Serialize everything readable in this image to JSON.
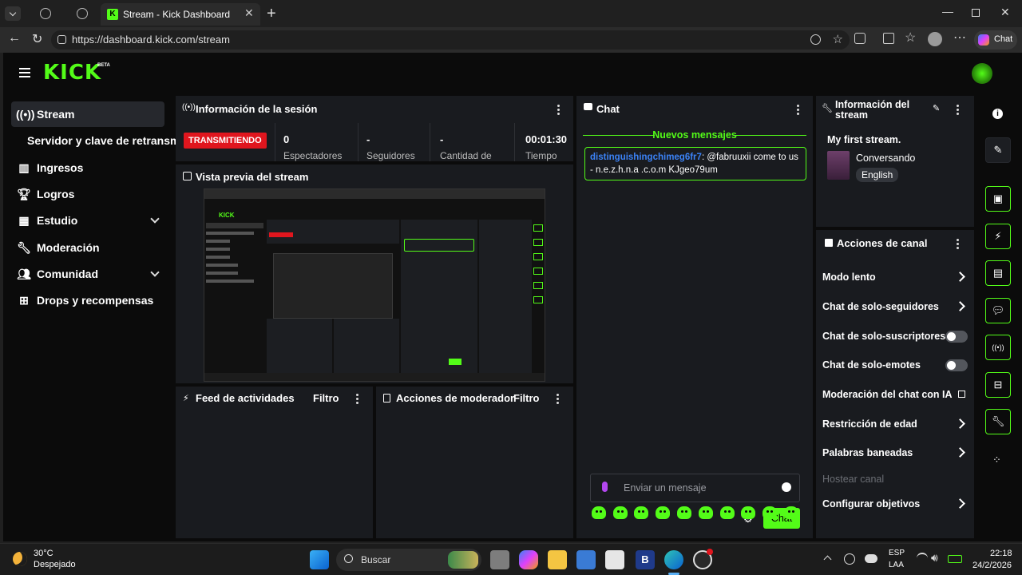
{
  "browser": {
    "tab_title": "Stream - Kick Dashboard",
    "url": "https://dashboard.kick.com/stream",
    "copilot_label": "Chat"
  },
  "brand": {
    "logo": "KICK",
    "beta": "BETA",
    "accent": "#53fc18"
  },
  "sidebar": {
    "items": [
      {
        "label": "Stream",
        "icon": "broadcast-icon"
      },
      {
        "label": "Servidor y clave de retransm"
      },
      {
        "label": "Ingresos",
        "icon": "chart-icon"
      },
      {
        "label": "Logros",
        "icon": "trophy-icon"
      },
      {
        "label": "Estudio",
        "icon": "studio-icon"
      },
      {
        "label": "Moderación",
        "icon": "wrench-icon"
      },
      {
        "label": "Comunidad",
        "icon": "people-icon"
      },
      {
        "label": "Drops y recompensas",
        "icon": "gift-icon"
      }
    ]
  },
  "session": {
    "title": "Información de la sesión",
    "status": "TRANSMITIENDO",
    "stats": [
      {
        "value": "0",
        "label": "Espectadores"
      },
      {
        "value": "-",
        "label": "Seguidores"
      },
      {
        "value": "-",
        "label": "Cantidad de"
      },
      {
        "value": "00:01:30",
        "label": "Tiempo"
      }
    ]
  },
  "preview": {
    "title": "Vista previa del stream"
  },
  "feed": {
    "title": "Feed de actividades",
    "filter": "Filtro"
  },
  "modactions": {
    "title": "Acciones de moderador",
    "filter": "Filtro"
  },
  "chat": {
    "title": "Chat",
    "new_messages": "Nuevos mensajes",
    "message": {
      "user": "distinguishingchimeg6fr7",
      "sep": ":",
      "text": " @fabruuxii come to us - n.e.z.h.n.a .c.o.m KJgeo79um"
    },
    "placeholder": "Enviar un mensaje",
    "send": "Chat"
  },
  "stream_info": {
    "title": "Información del stream",
    "stream_title": "My first stream.",
    "category": "Conversando",
    "language": "English"
  },
  "channel_actions": {
    "title": "Acciones de canal",
    "items": [
      {
        "label": "Modo lento",
        "control": "chevron"
      },
      {
        "label": "Chat de solo-seguidores",
        "control": "chevron"
      },
      {
        "label": "Chat de solo-suscriptores",
        "control": "toggle"
      },
      {
        "label": "Chat de solo-emotes",
        "control": "toggle"
      },
      {
        "label": "Moderación del chat con IA",
        "control": "external"
      },
      {
        "label": "Restricción de edad",
        "control": "chevron"
      },
      {
        "label": "Palabras baneadas",
        "control": "chevron"
      },
      {
        "label": "Hostear canal",
        "control": "none"
      },
      {
        "label": "Configurar objetivos",
        "control": "chevron"
      }
    ]
  },
  "taskbar": {
    "temp": "30°C",
    "weather": "Despejado",
    "search": "Buscar",
    "lang1": "ESP",
    "lang2": "LAA",
    "time": "22:18",
    "date": "24/2/2026"
  }
}
